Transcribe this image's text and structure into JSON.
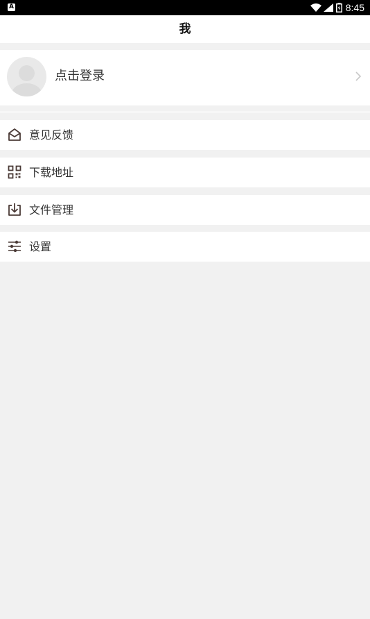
{
  "status_bar": {
    "left_icon": "A",
    "time": "8:45",
    "icons": [
      "wifi-icon",
      "signal-icon",
      "battery-icon"
    ]
  },
  "header": {
    "title": "我"
  },
  "profile": {
    "login_label": "点击登录",
    "avatar_icon": "default-avatar-icon",
    "chevron_icon": "chevron-right-icon"
  },
  "menu": {
    "items": [
      {
        "label": "意见反馈",
        "icon": "envelope-icon"
      },
      {
        "label": "下载地址",
        "icon": "qr-code-icon"
      },
      {
        "label": "文件管理",
        "icon": "download-tray-icon"
      },
      {
        "label": "设置",
        "icon": "sliders-icon"
      }
    ]
  },
  "colors": {
    "icon_color": "#4a3a36",
    "page_background": "#f1f1f1",
    "card_background": "#ffffff",
    "text_primary": "#333333"
  }
}
